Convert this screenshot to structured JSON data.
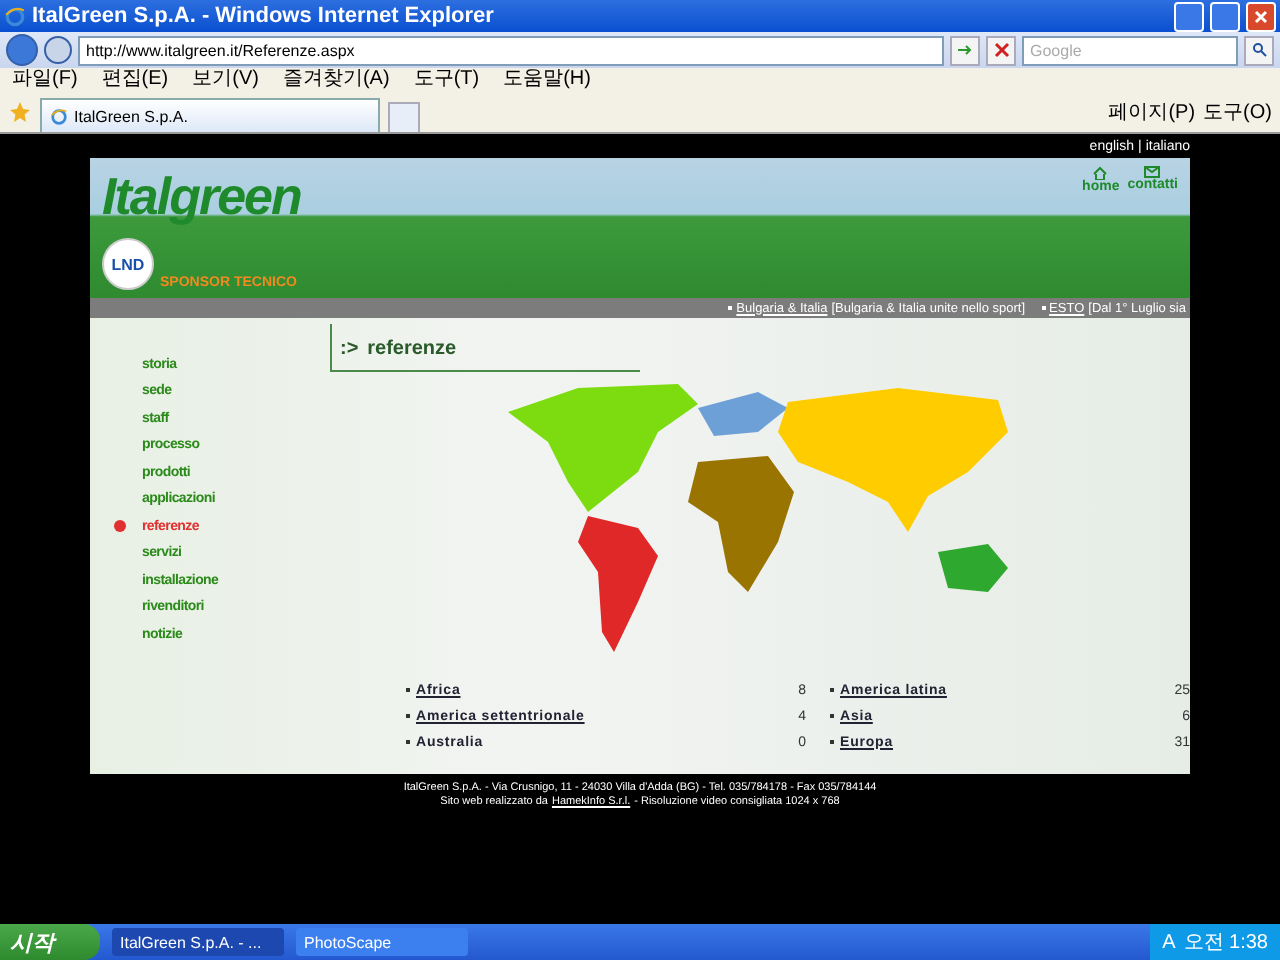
{
  "window": {
    "title": "ItalGreen S.p.A. - Windows Internet Explorer"
  },
  "address": {
    "url": "http://www.italgreen.it/Referenze.aspx"
  },
  "search": {
    "placeholder": "Google"
  },
  "menu": [
    "파일(F)",
    "편집(E)",
    "보기(V)",
    "즐겨찾기(A)",
    "도구(T)",
    "도움말(H)"
  ],
  "tab": {
    "label": "ItalGreen S.p.A."
  },
  "command_bar": [
    "페이지(P)",
    "도구(O)"
  ],
  "languages": [
    "english",
    "|",
    "italiano"
  ],
  "header": {
    "logo": "Italgreen",
    "badge": "LND",
    "sponsor": "SPONSOR TECNICO",
    "links": [
      {
        "label": "home",
        "kind": "home"
      },
      {
        "label": "contatti",
        "kind": "mail"
      }
    ]
  },
  "ticker": [
    {
      "link": "Bulgaria & Italia",
      "note": "[Bulgaria & Italia unite nello sport]"
    },
    {
      "link": "ESTO",
      "note": "[Dal 1° Luglio sia"
    }
  ],
  "nav": [
    {
      "label": "storia",
      "selected": false
    },
    {
      "label": "sede",
      "selected": false
    },
    {
      "label": "staff",
      "selected": false
    },
    {
      "label": "processo",
      "selected": false
    },
    {
      "label": "prodotti",
      "selected": false
    },
    {
      "label": "applicazioni",
      "selected": false
    },
    {
      "label": "referenze",
      "selected": true
    },
    {
      "label": "servizi",
      "selected": false
    },
    {
      "label": "installazione",
      "selected": false
    },
    {
      "label": "rivenditori",
      "selected": false
    },
    {
      "label": "notizie",
      "selected": false
    }
  ],
  "section_marker": ":>",
  "section_title": "referenze",
  "regions": [
    {
      "name": "Africa",
      "count": "8",
      "linked": true
    },
    {
      "name": "America settentrionale",
      "count": "4",
      "linked": true
    },
    {
      "name": "Australia",
      "count": "0",
      "linked": false
    },
    {
      "name": "America latina",
      "count": "25",
      "linked": true
    },
    {
      "name": "Asia",
      "count": "6",
      "linked": true
    },
    {
      "name": "Europa",
      "count": "31",
      "linked": true
    }
  ],
  "footer": {
    "address": "ItalGreen S.p.A. - Via Crusnigo, 11 - 24030 Villa d'Adda (BG) - Tel. 035/784178 - Fax 035/784144",
    "credit_prefix": "Sito web realizzato da",
    "credit_link": "HamekInfo S.r.l.",
    "credit_suffix": "- Risoluzione video consigliata 1024 x 768"
  },
  "taskbar": {
    "start": "시작",
    "tasks": [
      {
        "label": "ItalGreen S.p.A. - ...",
        "selected": true
      },
      {
        "label": "PhotoScape",
        "selected": false
      }
    ],
    "tray": "A",
    "clock": "오전 1:38"
  }
}
